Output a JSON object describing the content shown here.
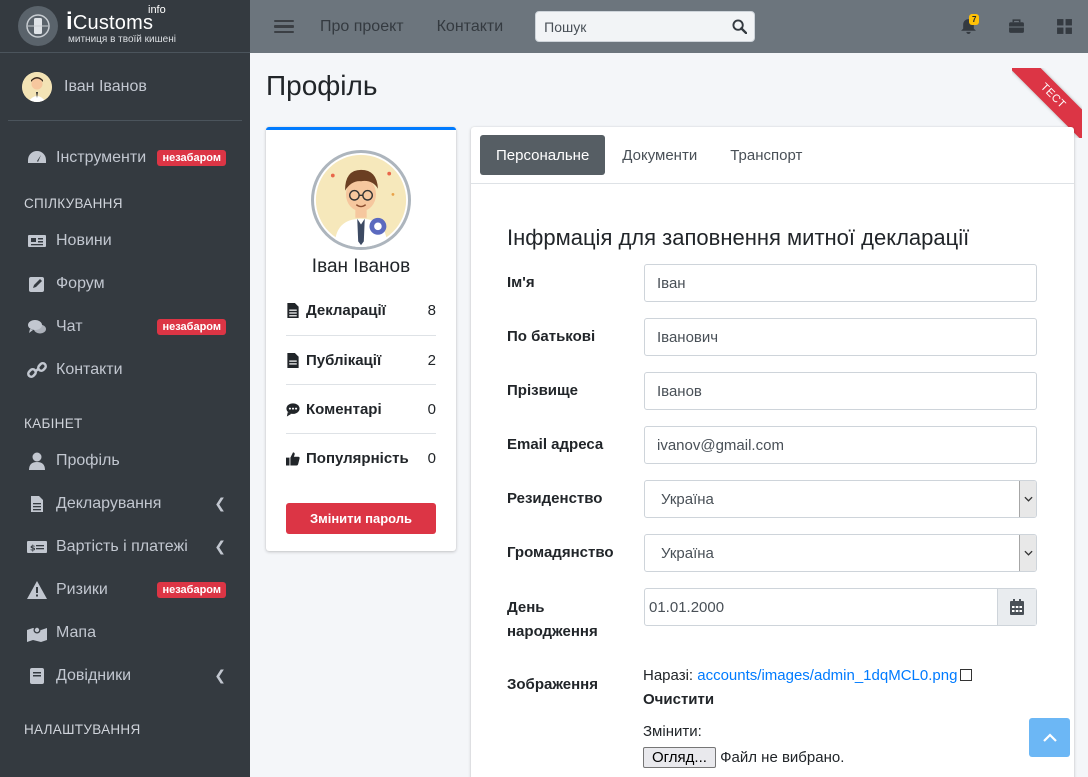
{
  "brand": {
    "i": "i",
    "name": "Customs",
    "sup": "info",
    "tagline": "митниця в твоїй кишені"
  },
  "user": {
    "name": "Іван Іванов"
  },
  "sidebar": {
    "tools": {
      "label": "Інструменти",
      "badge": "незабаром"
    },
    "section_communication": "СПІЛКУВАННЯ",
    "news": {
      "label": "Новини"
    },
    "forum": {
      "label": "Форум"
    },
    "chat": {
      "label": "Чат",
      "badge": "незабаром"
    },
    "contacts": {
      "label": "Контакти"
    },
    "section_cabinet": "КАБІНЕТ",
    "profile": {
      "label": "Профіль"
    },
    "declaring": {
      "label": "Декларування"
    },
    "costs": {
      "label": "Вартість і платежі"
    },
    "risks": {
      "label": "Ризики",
      "badge": "незабаром"
    },
    "map": {
      "label": "Мапа"
    },
    "references": {
      "label": "Довідники"
    },
    "section_settings": "НАЛАШТУВАННЯ"
  },
  "topbar": {
    "about": "Про проект",
    "contacts": "Контакти",
    "search_placeholder": "Пошук",
    "notification_count": "7"
  },
  "page": {
    "title": "Профіль",
    "ribbon": "ТЕСТ"
  },
  "profile_card": {
    "name": "Іван Іванов",
    "stats": [
      {
        "label": "Декларації",
        "value": "8"
      },
      {
        "label": "Публікації",
        "value": "2"
      },
      {
        "label": "Коментарі",
        "value": "0"
      },
      {
        "label": "Популярність",
        "value": "0"
      }
    ],
    "change_password": "Змінити пароль"
  },
  "tabs": [
    "Персональне",
    "Документи",
    "Транспорт"
  ],
  "form": {
    "title": "Інфрмація для заповнення митної декларації",
    "first_name": {
      "label": "Ім'я",
      "value": "Іван"
    },
    "patronymic": {
      "label": "По батькові",
      "value": "Іванович"
    },
    "last_name": {
      "label": "Прізвище",
      "value": "Іванов"
    },
    "email": {
      "label": "Email адреса",
      "value": "ivanov@gmail.com"
    },
    "residence": {
      "label": "Резиденство",
      "value": "Україна"
    },
    "citizenship": {
      "label": "Громадянство",
      "value": "Україна"
    },
    "birthdate": {
      "label": "День народження",
      "value": "01.01.2000"
    },
    "image": {
      "label": "Зображення",
      "current_prefix": "Наразі:",
      "current_file": "accounts/images/admin_1dqMCL0.png",
      "clear_label": "Очистити",
      "change_label": "Змінити:",
      "browse_label": "Огляд...",
      "no_file": "Файл не вибрано."
    }
  },
  "colors": {
    "sidebar": "#343a40",
    "topbar": "#6c757d",
    "accent": "#007bff",
    "danger": "#dc3545"
  }
}
